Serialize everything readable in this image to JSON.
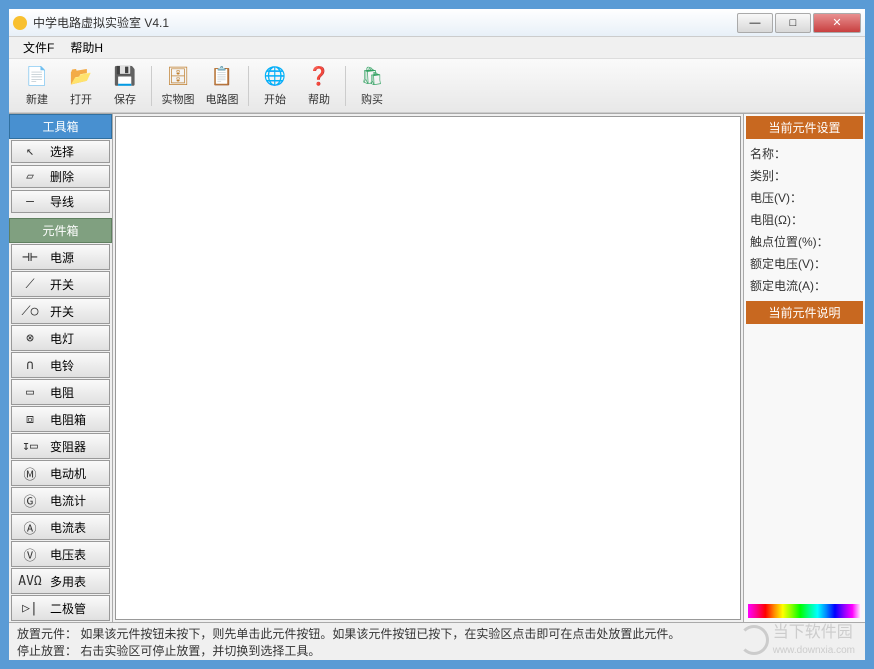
{
  "window": {
    "title": "中学电路虚拟实验室 V4.1"
  },
  "menu": {
    "file": "文件F",
    "help": "帮助H"
  },
  "toolbar": {
    "new": "新建",
    "open": "打开",
    "save": "保存",
    "real": "实物图",
    "diagram": "电路图",
    "start": "开始",
    "help": "帮助",
    "buy": "购买"
  },
  "left": {
    "toolbox_header": "工具箱",
    "tools": {
      "select": "选择",
      "delete": "删除",
      "wire": "导线"
    },
    "parts_header": "元件箱",
    "parts": [
      {
        "icon": "⊣⊢",
        "label": "电源"
      },
      {
        "icon": "⟋",
        "label": "开关"
      },
      {
        "icon": "⟋○",
        "label": "开关"
      },
      {
        "icon": "⊗",
        "label": "电灯"
      },
      {
        "icon": "∩",
        "label": "电铃"
      },
      {
        "icon": "▭",
        "label": "电阻"
      },
      {
        "icon": "⧈",
        "label": "电阻箱"
      },
      {
        "icon": "↧▭",
        "label": "变阻器"
      },
      {
        "icon": "Ⓜ",
        "label": "电动机"
      },
      {
        "icon": "Ⓖ",
        "label": "电流计"
      },
      {
        "icon": "Ⓐ",
        "label": "电流表"
      },
      {
        "icon": "Ⓥ",
        "label": "电压表"
      },
      {
        "icon": "AVΩ",
        "label": "多用表"
      },
      {
        "icon": "▷|",
        "label": "二极管"
      }
    ]
  },
  "right": {
    "settings_header": "当前元件设置",
    "desc_header": "当前元件说明",
    "rows": {
      "name": "名称：",
      "type": "类别：",
      "voltage": "电压(V)：",
      "resistance": "电阻(Ω)：",
      "contact": "触点位置(%)：",
      "rated_v": "额定电压(V)：",
      "rated_a": "额定电流(A)："
    }
  },
  "status": {
    "line1": "放置元件：  如果该元件按钮未按下，则先单击此元件按钮。如果该元件按钮已按下，在实验区点击即可在点击处放置此元件。",
    "line2": "停止放置：  右击实验区可停止放置，并切换到选择工具。"
  },
  "watermark": {
    "text": "当下软件园",
    "url": "www.downxia.com"
  }
}
